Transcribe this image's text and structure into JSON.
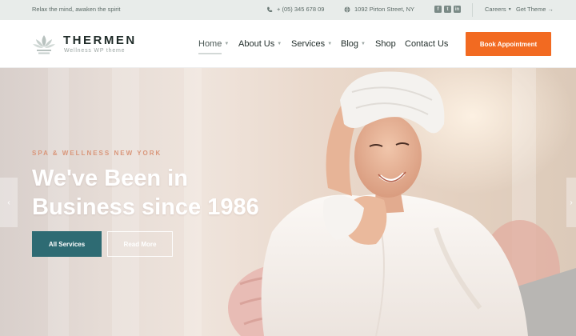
{
  "topbar": {
    "tagline": "Relax the mind, awaken the spirit",
    "phone": "+ (05) 345 678 09",
    "address": "1092 Pirton Street, NY",
    "socials": [
      "facebook-icon",
      "twitter-icon",
      "linkedin-icon"
    ],
    "careers": "Careers",
    "get_theme": "Get Theme"
  },
  "header": {
    "brand": "THERMEN",
    "brand_sub": "Wellness WP theme",
    "nav": [
      {
        "label": "Home",
        "has_dropdown": true,
        "active": true
      },
      {
        "label": "About Us",
        "has_dropdown": true
      },
      {
        "label": "Services",
        "has_dropdown": true
      },
      {
        "label": "Blog",
        "has_dropdown": true
      },
      {
        "label": "Shop",
        "has_dropdown": false
      },
      {
        "label": "Contact Us",
        "has_dropdown": false
      }
    ],
    "cta": "Book Appointment"
  },
  "hero": {
    "eyebrow": "SPA & WELLNESS NEW YORK",
    "title": "We've Been in Business since 1986",
    "primary_button": "All Services",
    "secondary_button": "Read More"
  },
  "colors": {
    "accent": "#f26a21",
    "teal": "#2e6b73",
    "eyebrow": "#d9967a",
    "topbar_bg": "#e8ecea"
  }
}
